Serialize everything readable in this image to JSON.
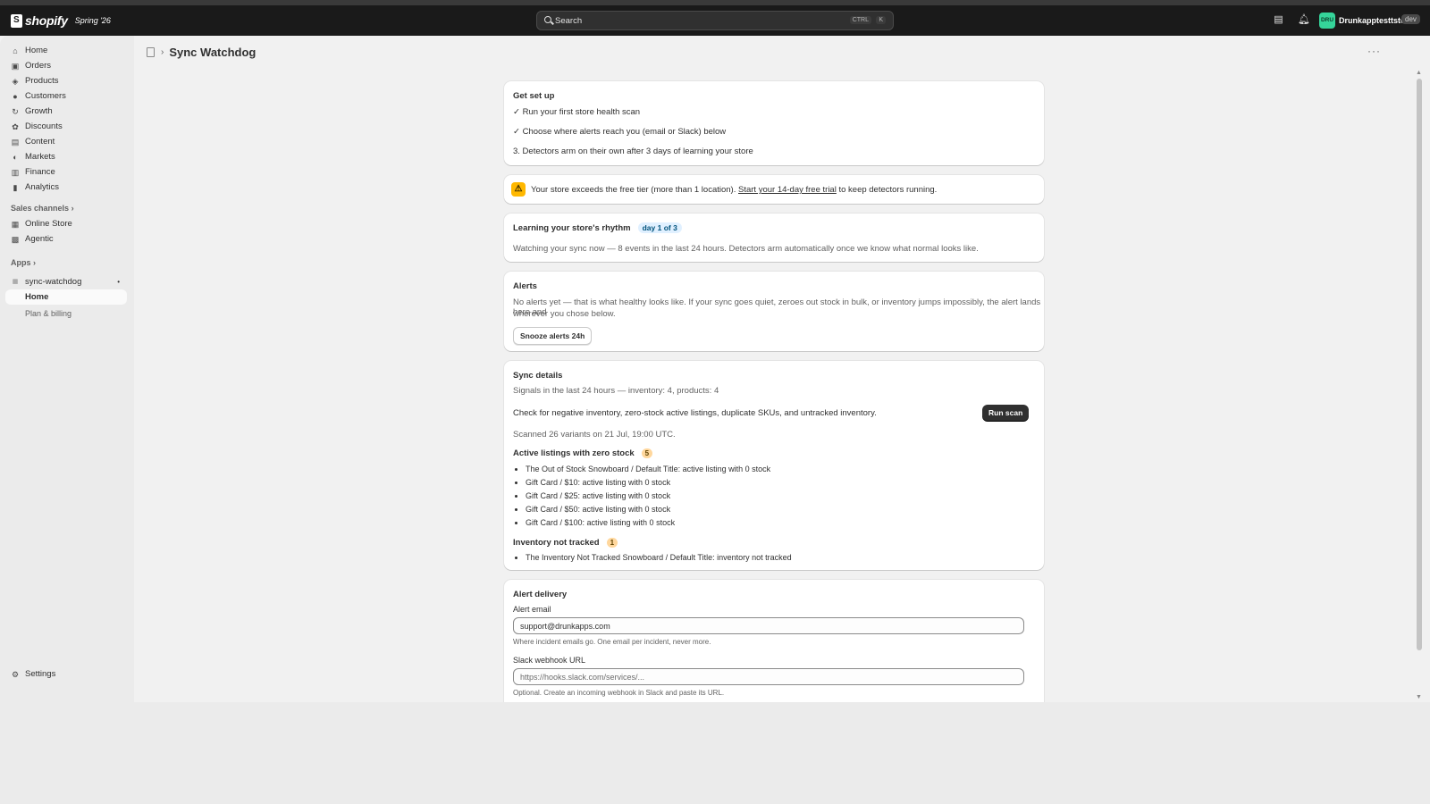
{
  "topbar": {
    "brand": "shopify",
    "season": "Spring '26",
    "search_placeholder": "Search",
    "shortcut_key1": "CTRL",
    "shortcut_key2": "K",
    "avatar_initials": "DRU",
    "store_name": "Drunkapptesttstore",
    "env_badge": "dev"
  },
  "sidebar": {
    "items": [
      {
        "label": "Home",
        "icon": "home-icon"
      },
      {
        "label": "Orders",
        "icon": "orders-icon"
      },
      {
        "label": "Products",
        "icon": "tag-icon"
      },
      {
        "label": "Customers",
        "icon": "person-icon"
      },
      {
        "label": "Growth",
        "icon": "growth-icon"
      },
      {
        "label": "Discounts",
        "icon": "discount-icon"
      },
      {
        "label": "Content",
        "icon": "content-icon"
      },
      {
        "label": "Markets",
        "icon": "globe-icon"
      },
      {
        "label": "Finance",
        "icon": "bank-icon"
      },
      {
        "label": "Analytics",
        "icon": "chart-icon"
      }
    ],
    "sales_channels_label": "Sales channels",
    "channels": [
      {
        "label": "Online Store",
        "icon": "store-icon"
      },
      {
        "label": "Agentic",
        "icon": "agentic-icon"
      }
    ],
    "apps_label": "Apps",
    "app_name": "sync-watchdog",
    "app_subitems": [
      "Home",
      "Plan & billing"
    ],
    "settings_label": "Settings"
  },
  "page": {
    "title": "Sync Watchdog"
  },
  "setup": {
    "title": "Get set up",
    "steps": [
      "✓ Run your first store health scan",
      "✓ Choose where alerts reach you (email or Slack) below",
      "3. Detectors arm on their own after 3 days of learning your store"
    ]
  },
  "banner": {
    "text_before": "Your store exceeds the free tier (more than 1 location).",
    "link": "Start your 14-day free trial",
    "text_after": "to keep detectors running."
  },
  "learning": {
    "title": "Learning your store's rhythm",
    "badge": "day 1 of 3",
    "body": "Watching your sync now — 8 events in the last 24 hours. Detectors arm automatically once we know what normal looks like."
  },
  "alerts": {
    "title": "Alerts",
    "body_line1": "No alerts yet — that is what healthy looks like. If your sync goes quiet, zeroes out stock in bulk, or inventory jumps impossibly, the alert lands here and",
    "body_line2": "wherever you chose below.",
    "snooze_label": "Snooze alerts 24h"
  },
  "sync": {
    "title": "Sync details",
    "signals": "Signals in the last 24 hours — inventory: 4, products: 4",
    "check": "Check for negative inventory, zero-stock active listings, duplicate SKUs, and untracked inventory.",
    "run_label": "Run scan",
    "scanned": "Scanned 26 variants on 21 Jul, 19:00 UTC.",
    "groups": [
      {
        "title": "Active listings with zero stock",
        "count": "5",
        "items": [
          "The Out of Stock Snowboard / Default Title: active listing with 0 stock",
          "Gift Card / $10: active listing with 0 stock",
          "Gift Card / $25: active listing with 0 stock",
          "Gift Card / $50: active listing with 0 stock",
          "Gift Card / $100: active listing with 0 stock"
        ]
      },
      {
        "title": "Inventory not tracked",
        "count": "1",
        "items": [
          "The Inventory Not Tracked Snowboard / Default Title: inventory not tracked"
        ]
      }
    ]
  },
  "delivery": {
    "title": "Alert delivery",
    "email_label": "Alert email",
    "email_value": "support@drunkapps.com",
    "email_help": "Where incident emails go. One email per incident, never more.",
    "slack_label": "Slack webhook URL",
    "slack_placeholder": "https://hooks.slack.com/services/...",
    "slack_help": "Optional. Create an incoming webhook in Slack and paste its URL."
  }
}
